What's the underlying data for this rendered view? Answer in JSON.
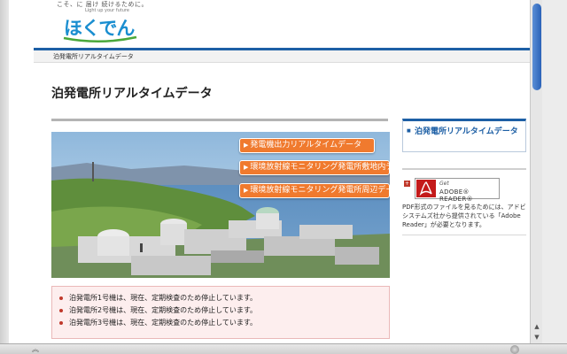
{
  "header": {
    "tagline": "こそ、に 届け 続けるために。",
    "logo_text": "ほくでん",
    "logo_subtext": "Light up your future"
  },
  "breadcrumb": "泊発電所リアルタイムデータ",
  "page_title": "泊発電所リアルタイムデータ",
  "hero_links": [
    {
      "label": "発電機出力リアルタイムデータ"
    },
    {
      "label": "環境放射線モニタリング発電所敷地内データ"
    },
    {
      "label": "環境放射線モニタリング発電所周辺データ"
    }
  ],
  "notices": [
    "泊発電所1号機は、現在、定期検査のため停止しています。",
    "泊発電所2号機は、現在、定期検査のため停止しています。",
    "泊発電所3号機は、現在、定期検査のため停止しています。"
  ],
  "sidebar": {
    "link": "泊発電所リアルタイムデータ",
    "adobe_get": "Get",
    "adobe_reader": "ADOBE® READER®",
    "pdf_note": "PDF形式のファイルを見るためには、アドビシステムズ社から提供されている「Adobe Reader」が必要となります。"
  },
  "colors": {
    "brand_blue": "#1d5fa5",
    "link_orange": "#f07a2e",
    "notice_bg": "#fdeeee"
  },
  "icons": {
    "scroll_up": "▲",
    "scroll_down": "▼",
    "link_arrow": "▶",
    "status_chevron": "︽"
  }
}
